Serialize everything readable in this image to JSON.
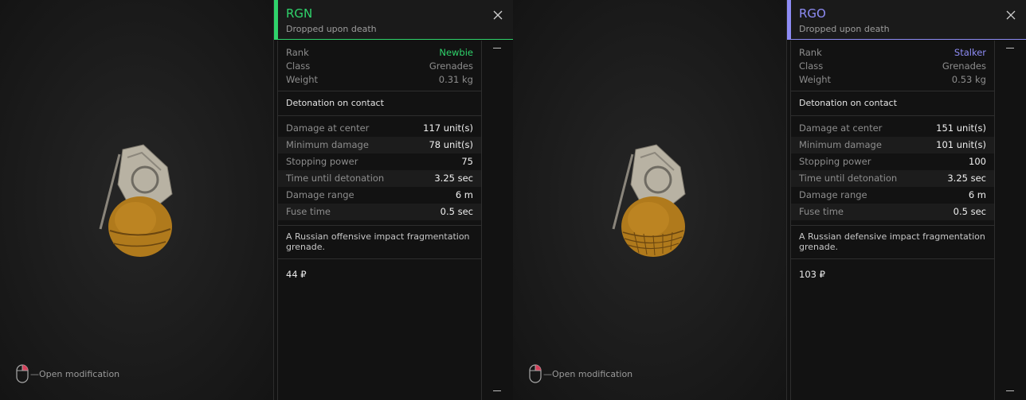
{
  "panels": [
    {
      "name": "RGN",
      "subtitle": "Dropped upon death",
      "accent_color": "#2fd36b",
      "rank_color": "#2fd36b",
      "rank": {
        "label": "Rank",
        "value": "Newbie"
      },
      "class": {
        "label": "Class",
        "value": "Grenades"
      },
      "weight": {
        "label": "Weight",
        "value": "0.31 kg"
      },
      "detonation": "Detonation on contact",
      "stats": [
        {
          "label": "Damage at center",
          "value": "117 unit(s)"
        },
        {
          "label": "Minimum damage",
          "value": "78 unit(s)"
        },
        {
          "label": "Stopping power",
          "value": "75"
        },
        {
          "label": "Time until detonation",
          "value": "3.25 sec"
        },
        {
          "label": "Damage range",
          "value": "6 m"
        },
        {
          "label": "Fuse time",
          "value": "0.5 sec"
        }
      ],
      "description": "A Russian offensive impact fragmentation grenade.",
      "price": "44 ₽",
      "open_modification": "—Open modification",
      "icons": {
        "close": "close-icon",
        "mouse": "mouse-icon",
        "item": "grenade-image"
      }
    },
    {
      "name": "RGO",
      "subtitle": "Dropped upon death",
      "accent_color": "#8e8cf5",
      "rank_color": "#8e8cf5",
      "rank": {
        "label": "Rank",
        "value": "Stalker"
      },
      "class": {
        "label": "Class",
        "value": "Grenades"
      },
      "weight": {
        "label": "Weight",
        "value": "0.53 kg"
      },
      "detonation": "Detonation on contact",
      "stats": [
        {
          "label": "Damage at center",
          "value": "151 unit(s)"
        },
        {
          "label": "Minimum damage",
          "value": "101 unit(s)"
        },
        {
          "label": "Stopping power",
          "value": "100"
        },
        {
          "label": "Time until detonation",
          "value": "3.25 sec"
        },
        {
          "label": "Damage range",
          "value": "6 m"
        },
        {
          "label": "Fuse time",
          "value": "0.5 sec"
        }
      ],
      "description": "A Russian defensive impact fragmentation grenade.",
      "price": "103 ₽",
      "open_modification": "—Open modification",
      "icons": {
        "close": "close-icon",
        "mouse": "mouse-icon",
        "item": "grenade-image"
      }
    }
  ]
}
